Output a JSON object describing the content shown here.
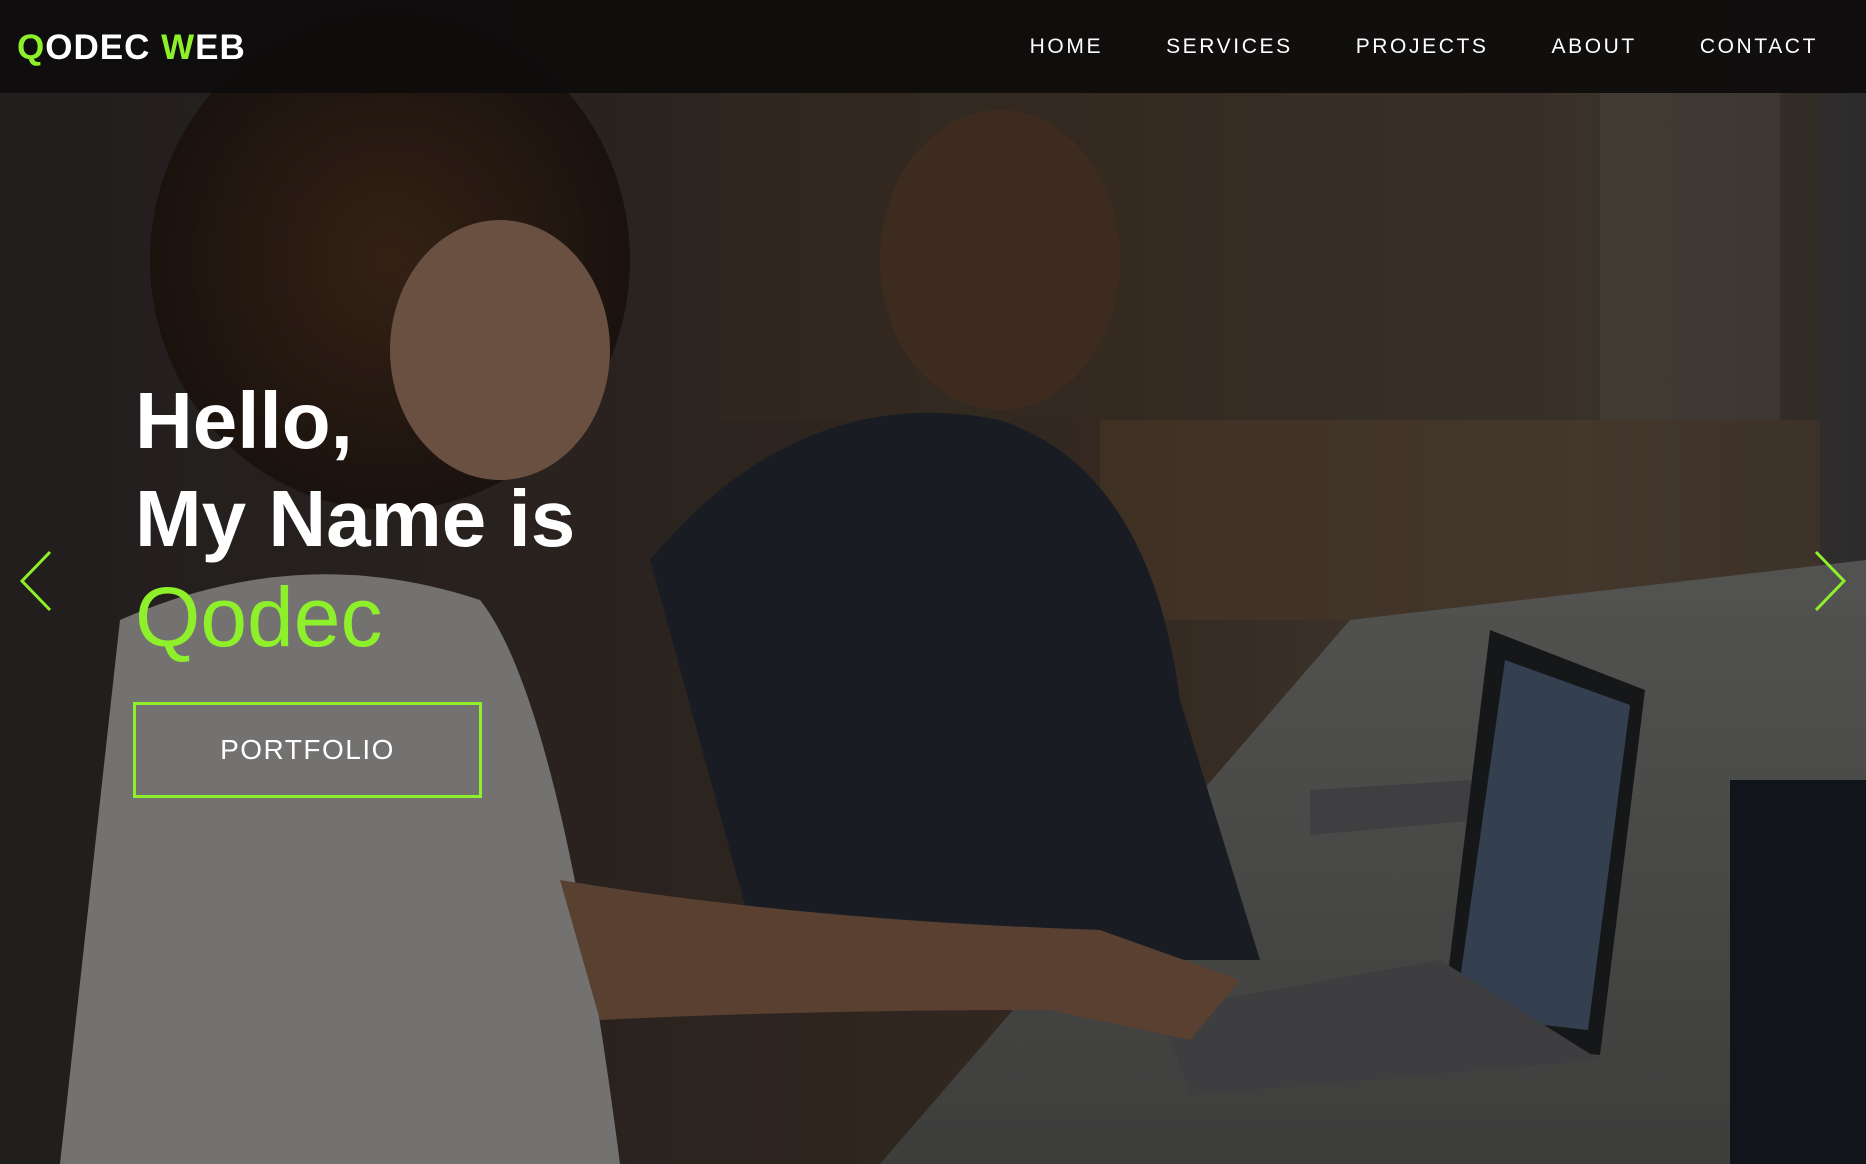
{
  "brand": {
    "name_part1": "Q",
    "name_part2": "ODEC ",
    "name_part3": "W",
    "name_part4": "EB",
    "accent_color": "#8ef02a"
  },
  "nav": {
    "items": [
      {
        "label": "HOME"
      },
      {
        "label": "SERVICES"
      },
      {
        "label": "PROJECTS"
      },
      {
        "label": "ABOUT"
      },
      {
        "label": "CONTACT"
      }
    ]
  },
  "hero": {
    "line1": "Hello,",
    "line2": "My Name is",
    "name": "Qodec",
    "cta_label": "PORTFOLIO",
    "background": "photo-two-people-working-on-laptops-in-cafe"
  },
  "slider": {
    "prev_icon": "chevron-left-icon",
    "next_icon": "chevron-right-icon"
  }
}
